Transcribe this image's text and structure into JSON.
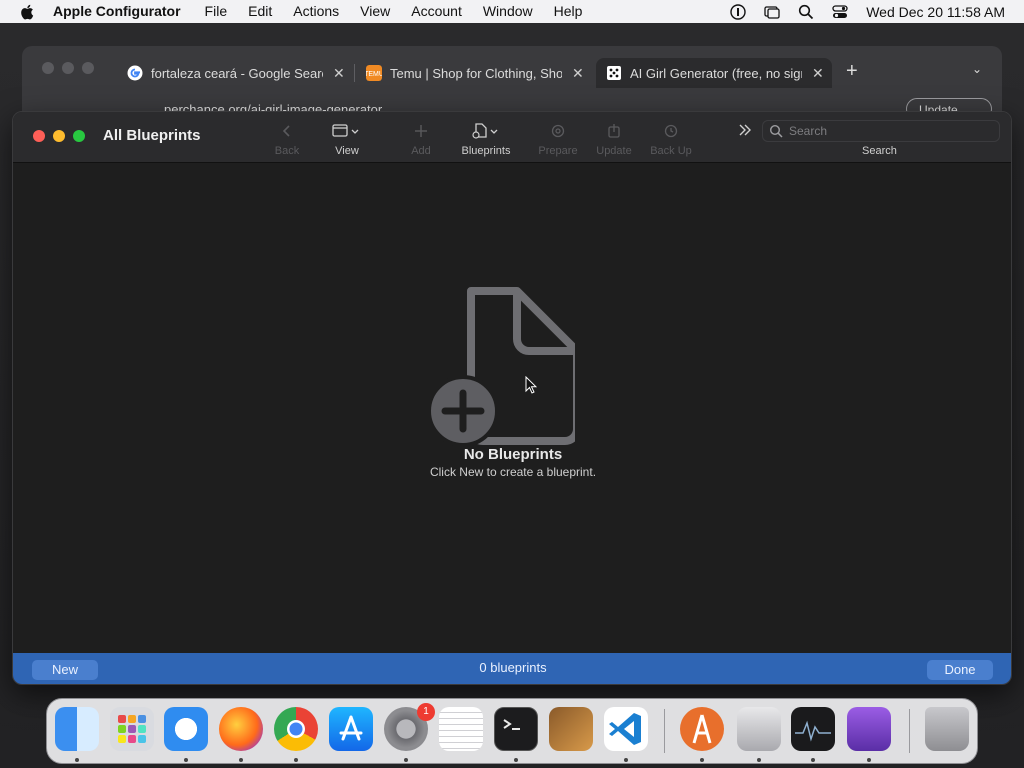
{
  "menubar": {
    "app_name": "Apple Configurator",
    "menus": [
      "File",
      "Edit",
      "Actions",
      "View",
      "Account",
      "Window",
      "Help"
    ],
    "clock": "Wed Dec 20  11:58 AM"
  },
  "browser": {
    "tabs": [
      {
        "label": "fortaleza ceará - Google Search",
        "favicon_color": "#ffffff"
      },
      {
        "label": "Temu | Shop for Clothing, Shoes",
        "favicon_color": "#f08a24"
      },
      {
        "label": "AI Girl Generator (free, no sign",
        "favicon_color": "#ffffff"
      }
    ],
    "url": "perchance.org/ai-girl-image-generator",
    "update_label": "Update"
  },
  "configurator": {
    "window_title": "All Blueprints",
    "toolbar": {
      "back": "Back",
      "view": "View",
      "add": "Add",
      "blueprints": "Blueprints",
      "prepare": "Prepare",
      "update": "Update",
      "back_up": "Back Up",
      "search_placeholder": "Search",
      "search_label": "Search"
    },
    "empty_state": {
      "title": "No Blueprints",
      "subtitle": "Click New to create a blueprint."
    },
    "bottom": {
      "new_label": "New",
      "count": "0 blueprints",
      "done_label": "Done"
    }
  },
  "dock": {
    "badge_count": "1",
    "apps": [
      "finder",
      "launchpad",
      "safari",
      "firefox",
      "chrome",
      "app-store",
      "system-settings",
      "textedit",
      "terminal",
      "garageband",
      "vscode",
      "apple-configurator",
      "migration-assistant",
      "activity-monitor",
      "app-purple",
      "trash"
    ]
  }
}
